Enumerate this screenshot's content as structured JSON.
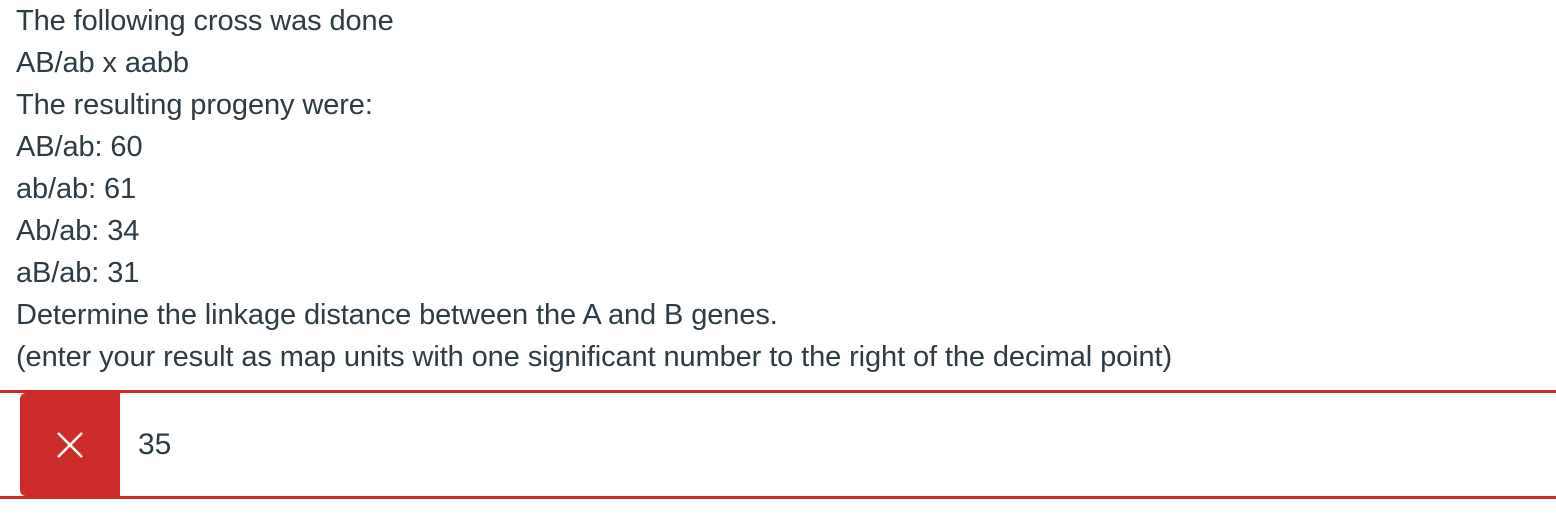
{
  "question": {
    "lines": [
      "The following cross was done",
      "AB/ab x aabb",
      "The resulting progeny were:",
      "AB/ab: 60",
      "ab/ab: 61",
      "Ab/ab: 34",
      "aB/ab: 31",
      "Determine the linkage distance between the A and B genes.",
      "(enter your result as map units with one significant number to the right of the decimal point)"
    ],
    "cross": "AB/ab x aabb",
    "progeny": [
      {
        "genotype": "AB/ab",
        "count": "60"
      },
      {
        "genotype": "ab/ab",
        "count": "61"
      },
      {
        "genotype": "Ab/ab",
        "count": "34"
      },
      {
        "genotype": "aB/ab",
        "count": "31"
      }
    ]
  },
  "answer": {
    "status_icon": "x-icon",
    "status": "incorrect",
    "value": "35",
    "placeholder": ""
  },
  "colors": {
    "text": "#2D3B45",
    "incorrect_red": "#CC2B28",
    "background": "#FFFFFF"
  }
}
